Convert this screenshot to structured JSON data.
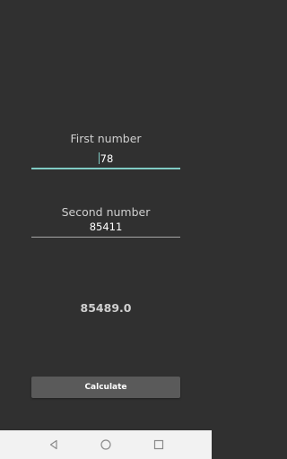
{
  "first_field": {
    "label": "First number",
    "value": "78"
  },
  "second_field": {
    "label": "Second number",
    "value": "85411"
  },
  "result": {
    "text": "85489.0"
  },
  "calculate_button": {
    "label": "Calculate"
  },
  "colors": {
    "background": "#303030",
    "accent": "#80cbc4",
    "button": "#5a5a5a",
    "navbar": "#f2f2f2"
  },
  "navbar": {
    "icons": [
      "back-icon",
      "home-icon",
      "recents-icon"
    ]
  }
}
